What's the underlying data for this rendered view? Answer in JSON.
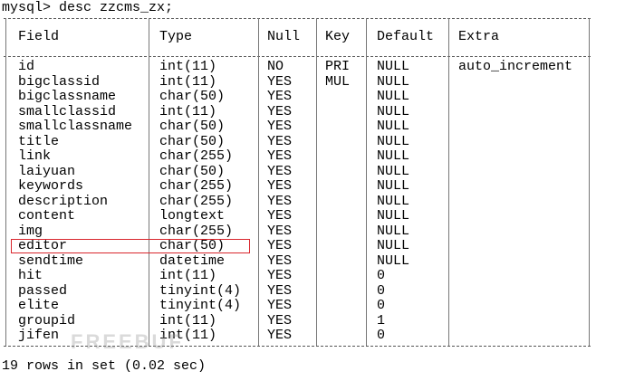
{
  "terminal": {
    "prompt": "mysql> desc zzcms_zx;",
    "footer": "19 rows in set (0.02 sec)"
  },
  "table": {
    "columns": [
      "Field",
      "Type",
      "Null",
      "Key",
      "Default",
      "Extra"
    ],
    "rows": [
      {
        "field": "id",
        "type": "int(11)",
        "null": "NO",
        "key": "PRI",
        "default": "NULL",
        "extra": "auto_increment"
      },
      {
        "field": "bigclassid",
        "type": "int(11)",
        "null": "YES",
        "key": "MUL",
        "default": "NULL",
        "extra": ""
      },
      {
        "field": "bigclassname",
        "type": "char(50)",
        "null": "YES",
        "key": "",
        "default": "NULL",
        "extra": ""
      },
      {
        "field": "smallclassid",
        "type": "int(11)",
        "null": "YES",
        "key": "",
        "default": "NULL",
        "extra": ""
      },
      {
        "field": "smallclassname",
        "type": "char(50)",
        "null": "YES",
        "key": "",
        "default": "NULL",
        "extra": ""
      },
      {
        "field": "title",
        "type": "char(50)",
        "null": "YES",
        "key": "",
        "default": "NULL",
        "extra": ""
      },
      {
        "field": "link",
        "type": "char(255)",
        "null": "YES",
        "key": "",
        "default": "NULL",
        "extra": ""
      },
      {
        "field": "laiyuan",
        "type": "char(50)",
        "null": "YES",
        "key": "",
        "default": "NULL",
        "extra": ""
      },
      {
        "field": "keywords",
        "type": "char(255)",
        "null": "YES",
        "key": "",
        "default": "NULL",
        "extra": ""
      },
      {
        "field": "description",
        "type": "char(255)",
        "null": "YES",
        "key": "",
        "default": "NULL",
        "extra": ""
      },
      {
        "field": "content",
        "type": "longtext",
        "null": "YES",
        "key": "",
        "default": "NULL",
        "extra": ""
      },
      {
        "field": "img",
        "type": "char(255)",
        "null": "YES",
        "key": "",
        "default": "NULL",
        "extra": ""
      },
      {
        "field": "editor",
        "type": "char(50)",
        "null": "YES",
        "key": "",
        "default": "NULL",
        "extra": ""
      },
      {
        "field": "sendtime",
        "type": "datetime",
        "null": "YES",
        "key": "",
        "default": "NULL",
        "extra": ""
      },
      {
        "field": "hit",
        "type": "int(11)",
        "null": "YES",
        "key": "",
        "default": "0",
        "extra": ""
      },
      {
        "field": "passed",
        "type": "tinyint(4)",
        "null": "YES",
        "key": "",
        "default": "0",
        "extra": ""
      },
      {
        "field": "elite",
        "type": "tinyint(4)",
        "null": "YES",
        "key": "",
        "default": "0",
        "extra": ""
      },
      {
        "field": "groupid",
        "type": "int(11)",
        "null": "YES",
        "key": "",
        "default": "1",
        "extra": ""
      },
      {
        "field": "jifen",
        "type": "int(11)",
        "null": "YES",
        "key": "",
        "default": "0",
        "extra": ""
      }
    ],
    "highlighted_row": "editor",
    "highlight_color": "#d9262d"
  },
  "watermark": "FREEBUF"
}
